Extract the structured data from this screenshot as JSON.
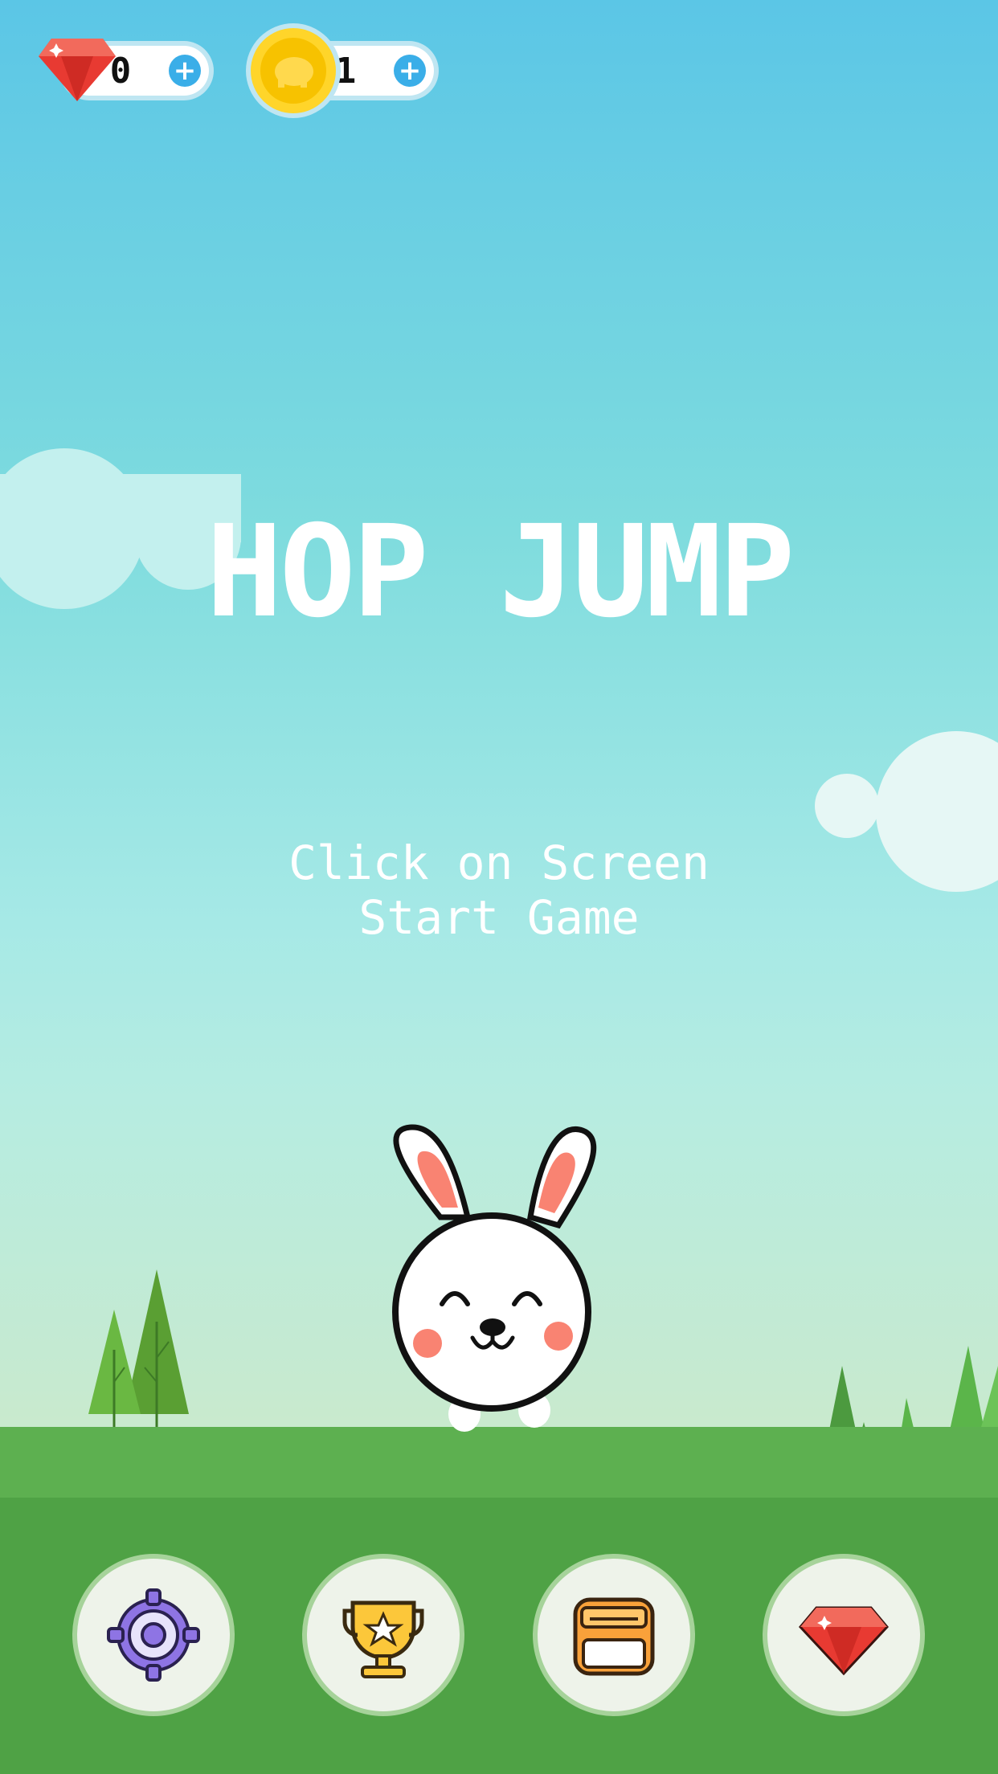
{
  "hud": {
    "gems": {
      "icon": "gem-icon",
      "value": "0",
      "add": "+"
    },
    "coins": {
      "icon": "coin-icon",
      "value": "1",
      "add": "+"
    }
  },
  "game": {
    "title": "HOP JUMP",
    "hint_line1": "Click on Screen",
    "hint_line2": "Start Game",
    "character": "bunny-icon"
  },
  "menu": [
    {
      "icon": "gear-icon",
      "label": "settings"
    },
    {
      "icon": "trophy-icon",
      "label": "leaderboard"
    },
    {
      "icon": "shop-icon",
      "label": "shop"
    },
    {
      "icon": "gem-icon",
      "label": "gems"
    }
  ],
  "colors": {
    "sky_top": "#5bc6e6",
    "grass": "#5db050",
    "grass_dark": "#4fa245",
    "accent_blue": "#3aaee8",
    "gem_red": "#e83a32"
  }
}
